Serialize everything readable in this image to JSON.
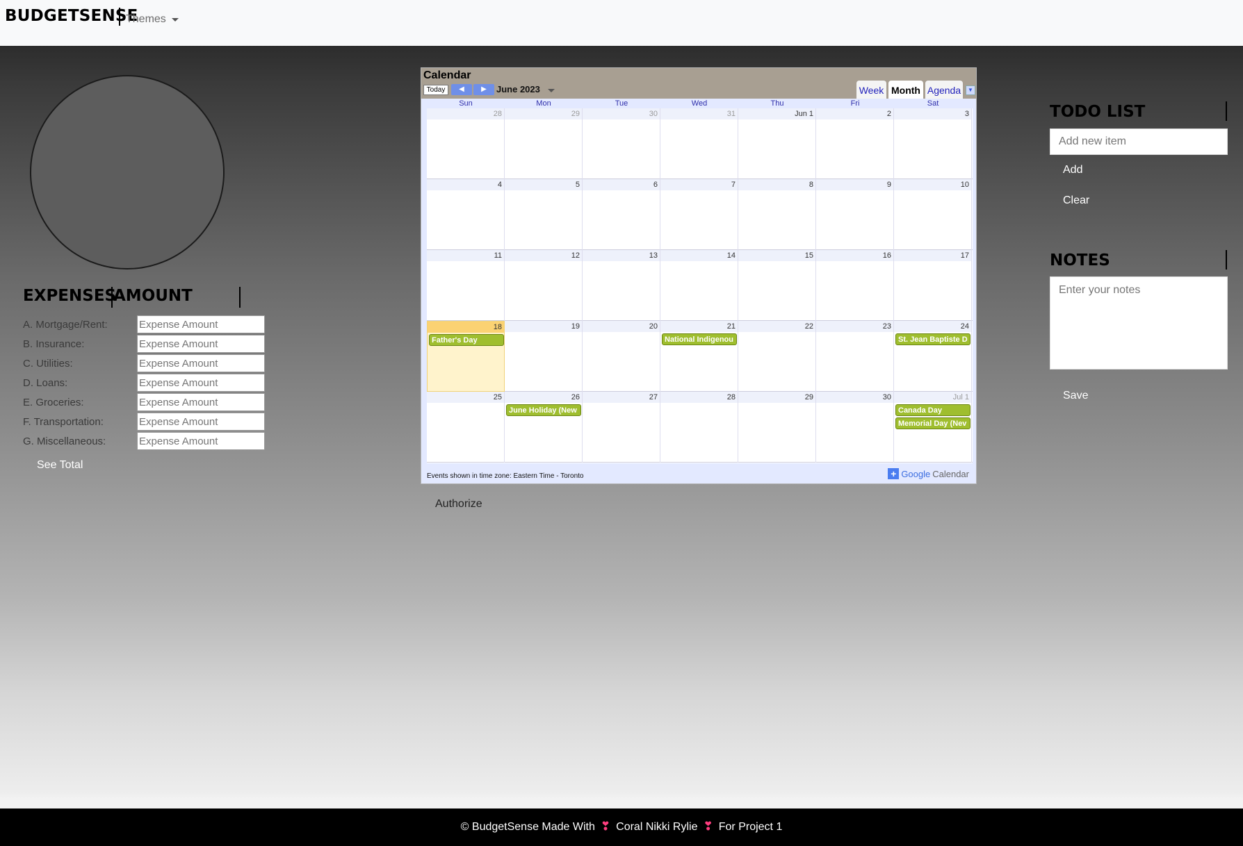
{
  "navbar": {
    "brand": "BUDGETSENSE",
    "themes_label": "Themes"
  },
  "expenses": {
    "header_expenses": "EXPENSES",
    "header_amount": "AMOUNT",
    "rows": [
      {
        "label": "A. Mortgage/Rent:",
        "placeholder": "Expense Amount"
      },
      {
        "label": "B. Insurance:",
        "placeholder": "Expense Amount"
      },
      {
        "label": "C. Utilities:",
        "placeholder": "Expense Amount"
      },
      {
        "label": "D. Loans:",
        "placeholder": "Expense Amount"
      },
      {
        "label": "E. Groceries:",
        "placeholder": "Expense Amount"
      },
      {
        "label": "F. Transportation:",
        "placeholder": "Expense Amount"
      },
      {
        "label": "G. Miscellaneous:",
        "placeholder": "Expense Amount"
      }
    ],
    "see_total": "See Total"
  },
  "calendar": {
    "title": "Calendar",
    "today": "Today",
    "month": "June 2023",
    "tabs": {
      "week": "Week",
      "month": "Month",
      "agenda": "Agenda"
    },
    "days_of_week": [
      "Sun",
      "Mon",
      "Tue",
      "Wed",
      "Thu",
      "Fri",
      "Sat"
    ],
    "weeks": [
      [
        "28",
        "29",
        "30",
        "31",
        "Jun 1",
        "2",
        "3"
      ],
      [
        "4",
        "5",
        "6",
        "7",
        "8",
        "9",
        "10"
      ],
      [
        "11",
        "12",
        "13",
        "14",
        "15",
        "16",
        "17"
      ],
      [
        "18",
        "19",
        "20",
        "21",
        "22",
        "23",
        "24"
      ],
      [
        "25",
        "26",
        "27",
        "28",
        "29",
        "30",
        "Jul 1"
      ]
    ],
    "events": {
      "fathers_day": "Father's Day",
      "national_indigenous": "National Indigenou",
      "st_jean": "St. Jean Baptiste D",
      "june_holiday": "June Holiday (New",
      "canada_day": "Canada Day",
      "memorial_day": "Memorial Day (Nev"
    },
    "footer": "Events shown in time zone: Eastern Time - Toronto",
    "google_calendar": {
      "google": "Google",
      "calendar": "Calendar"
    }
  },
  "authorize": "Authorize",
  "todo": {
    "title": "TODO LIST",
    "placeholder": "Add new item",
    "add": "Add",
    "clear": "Clear"
  },
  "notes": {
    "title": "NOTES",
    "placeholder": "Enter your notes",
    "save": "Save"
  },
  "footer": {
    "part1": "© BudgetSense Made With",
    "part2": "Coral Nikki Rylie",
    "part3": "For Project 1"
  }
}
